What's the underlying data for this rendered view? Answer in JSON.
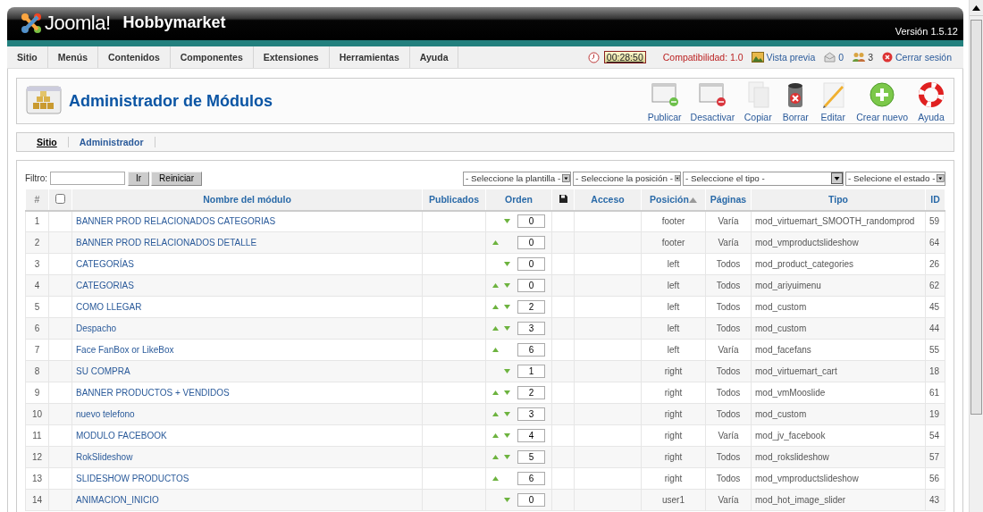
{
  "header": {
    "logo": "Joomla!",
    "site_name": "Hobbymarket",
    "version": "Versión 1.5.12"
  },
  "menu": [
    "Sitio",
    "Menús",
    "Contenidos",
    "Componentes",
    "Extensiones",
    "Herramientas",
    "Ayuda"
  ],
  "status": {
    "timer": "00:28:50",
    "compat": "Compatibilidad: 1.0",
    "preview": "Vista previa",
    "messages": "0",
    "users": "3",
    "logout": "Cerrar sesión"
  },
  "toolbar": {
    "title": "Administrador de Módulos",
    "buttons": [
      {
        "label": "Publicar",
        "kind": "publish"
      },
      {
        "label": "Desactivar",
        "kind": "unpublish"
      },
      {
        "label": "Copiar",
        "kind": "copy"
      },
      {
        "label": "Borrar",
        "kind": "delete"
      },
      {
        "label": "Editar",
        "kind": "edit"
      },
      {
        "label": "Crear nuevo",
        "kind": "new"
      },
      {
        "label": "Ayuda",
        "kind": "help"
      }
    ]
  },
  "submenu": [
    {
      "label": "Sitio",
      "selected": true
    },
    {
      "label": "Administrador",
      "selected": false
    }
  ],
  "filter": {
    "label": "Filtro:",
    "buttons": [
      "Ir",
      "Reiniciar"
    ],
    "selects": [
      "- Seleccione la plantilla -",
      "- Seleccione la posición -",
      "- Seleccione el tipo -",
      "- Selecione el estado -"
    ]
  },
  "table": {
    "columns": [
      {
        "label": "#",
        "kind": "text",
        "sorted": false
      },
      {
        "kind": "checkbox",
        "checked": false
      },
      {
        "label": "Nombre del módulo",
        "kind": "link",
        "sorted": false
      },
      {
        "label": "Publicados",
        "kind": "link",
        "sorted": false
      },
      {
        "label": "Orden",
        "kind": "link",
        "sorted": false
      },
      {
        "kind": "save"
      },
      {
        "label": "Acceso",
        "kind": "link",
        "sorted": false
      },
      {
        "label": "Posición",
        "kind": "link",
        "sorted": true
      },
      {
        "label": "Páginas",
        "kind": "link",
        "sorted": false
      },
      {
        "label": "Tipo",
        "kind": "link",
        "sorted": false
      },
      {
        "label": "ID",
        "kind": "link",
        "sorted": false
      }
    ],
    "rows": [
      {
        "num": "1",
        "name": "BANNER PROD RELACIONADOS CATEGORIAS",
        "up": false,
        "down": true,
        "order": "0",
        "position": "footer",
        "pages": "Varía",
        "type": "mod_virtuemart_SMOOTH_randomprod",
        "id": "59"
      },
      {
        "num": "2",
        "name": "BANNER PROD RELACIONADOS DETALLE",
        "up": true,
        "down": false,
        "order": "0",
        "position": "footer",
        "pages": "Varía",
        "type": "mod_vmproductslideshow",
        "id": "64"
      },
      {
        "num": "3",
        "name": "CATEGORÍAS",
        "up": false,
        "down": true,
        "order": "0",
        "position": "left",
        "pages": "Todos",
        "type": "mod_product_categories",
        "id": "26"
      },
      {
        "num": "4",
        "name": "CATEGORIAS",
        "up": true,
        "down": true,
        "order": "0",
        "position": "left",
        "pages": "Todos",
        "type": "mod_ariyuimenu",
        "id": "62"
      },
      {
        "num": "5",
        "name": "COMO LLEGAR",
        "up": true,
        "down": true,
        "order": "2",
        "position": "left",
        "pages": "Todos",
        "type": "mod_custom",
        "id": "45"
      },
      {
        "num": "6",
        "name": "Despacho",
        "up": true,
        "down": true,
        "order": "3",
        "position": "left",
        "pages": "Todos",
        "type": "mod_custom",
        "id": "44"
      },
      {
        "num": "7",
        "name": "Face FanBox or LikeBox",
        "up": true,
        "down": false,
        "order": "6",
        "position": "left",
        "pages": "Varía",
        "type": "mod_facefans",
        "id": "55"
      },
      {
        "num": "8",
        "name": "SU COMPRA",
        "up": false,
        "down": true,
        "order": "1",
        "position": "right",
        "pages": "Todos",
        "type": "mod_virtuemart_cart",
        "id": "18"
      },
      {
        "num": "9",
        "name": "BANNER PRODUCTOS + VENDIDOS",
        "up": true,
        "down": true,
        "order": "2",
        "position": "right",
        "pages": "Todos",
        "type": "mod_vmMooslide",
        "id": "61"
      },
      {
        "num": "10",
        "name": "nuevo telefono",
        "up": true,
        "down": true,
        "order": "3",
        "position": "right",
        "pages": "Todos",
        "type": "mod_custom",
        "id": "19"
      },
      {
        "num": "11",
        "name": "MODULO FACEBOOK",
        "up": true,
        "down": true,
        "order": "4",
        "position": "right",
        "pages": "Varía",
        "type": "mod_jv_facebook",
        "id": "54"
      },
      {
        "num": "12",
        "name": "RokSlideshow",
        "up": true,
        "down": true,
        "order": "5",
        "position": "right",
        "pages": "Todos",
        "type": "mod_rokslideshow",
        "id": "57"
      },
      {
        "num": "13",
        "name": "SLIDESHOW PRODUCTOS",
        "up": true,
        "down": false,
        "order": "6",
        "position": "right",
        "pages": "Todos",
        "type": "mod_vmproductslideshow",
        "id": "56"
      },
      {
        "num": "14",
        "name": "ANIMACION_INICIO",
        "up": false,
        "down": true,
        "order": "0",
        "position": "user1",
        "pages": "Varía",
        "type": "mod_hot_image_slider",
        "id": "43"
      }
    ]
  }
}
